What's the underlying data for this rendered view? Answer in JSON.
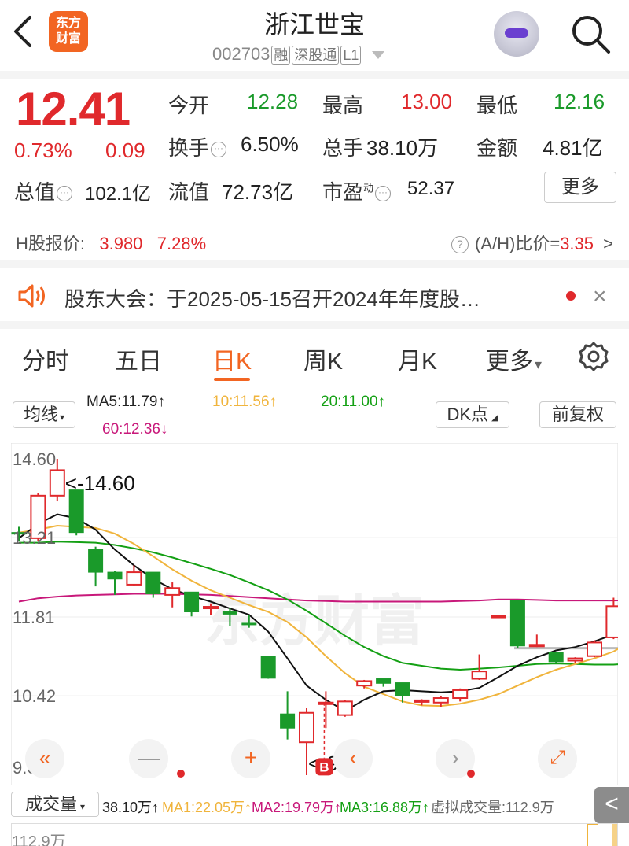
{
  "header": {
    "logo_text": [
      "东方",
      "财富"
    ],
    "title": "浙江世宝",
    "code": "002703",
    "tags": [
      "融",
      "深股通",
      "L1"
    ]
  },
  "quote": {
    "price": "12.41",
    "change_pct": "0.73%",
    "change": "0.09",
    "open_label": "今开",
    "open": "12.28",
    "high_label": "最高",
    "high": "13.00",
    "low_label": "最低",
    "low": "12.16",
    "turnover_label": "换手",
    "turnover": "6.50%",
    "volume_label": "总手",
    "volume": "38.10万",
    "amount_label": "金额",
    "amount": "4.81亿",
    "mktcap_label": "总值",
    "mktcap": "102.1亿",
    "float_label": "流值",
    "float": "72.73亿",
    "pe_label": "市盈",
    "pe_sup": "动",
    "pe": "52.37",
    "more": "更多"
  },
  "hshare": {
    "label": "H股报价:",
    "price": "3.980",
    "pct": "7.28%",
    "ah_label": "(A/H)比价=",
    "ah_value": "3.35",
    "arrow": ">"
  },
  "notice": {
    "text": "股东大会：于2025-05-15召开2024年年度股…",
    "close": "×"
  },
  "tabs": [
    "分时",
    "五日",
    "日K",
    "周K",
    "月K",
    "更多"
  ],
  "tab_more_arrow": "▾",
  "ma_bar": {
    "mode": "均线",
    "ma5": "MA5:11.79↑",
    "ma10": "10:11.56↑",
    "ma20": "20:11.00↑",
    "ma60": "60:12.36↓",
    "dk": "DK点",
    "adjust": "前复权"
  },
  "colors": {
    "up": "#e0292c",
    "down": "#1a9a2a",
    "ma5": "#111111",
    "ma10": "#f0b43c",
    "ma20": "#14a014",
    "ma60": "#c8187a",
    "accent": "#f26522",
    "signal": "#3aa0e8"
  },
  "chart_data": {
    "type": "candlestick",
    "y_ticks": [
      "14.60",
      "13.21",
      "11.81",
      "10.42",
      "9.02"
    ],
    "ylim": [
      9.02,
      14.6
    ],
    "max_label": "<-14.60",
    "min_label": "<-9.02",
    "buy_marker": "B",
    "sell_marker": "S",
    "candles": [
      {
        "o": 13.3,
        "h": 13.4,
        "l": 13.15,
        "c": 13.28
      },
      {
        "o": 13.2,
        "h": 14.0,
        "l": 13.15,
        "c": 13.95
      },
      {
        "o": 13.95,
        "h": 14.6,
        "l": 13.85,
        "c": 14.4
      },
      {
        "o": 14.05,
        "h": 14.05,
        "l": 13.25,
        "c": 13.3
      },
      {
        "o": 13.0,
        "h": 13.05,
        "l": 12.35,
        "c": 12.6
      },
      {
        "o": 12.6,
        "h": 12.62,
        "l": 12.2,
        "c": 12.48
      },
      {
        "o": 12.38,
        "h": 12.72,
        "l": 12.36,
        "c": 12.6
      },
      {
        "o": 12.6,
        "h": 12.6,
        "l": 12.15,
        "c": 12.22
      },
      {
        "o": 12.2,
        "h": 12.42,
        "l": 11.98,
        "c": 12.32
      },
      {
        "o": 12.25,
        "h": 12.25,
        "l": 11.82,
        "c": 11.9
      },
      {
        "o": 11.98,
        "h": 12.05,
        "l": 11.85,
        "c": 11.99
      },
      {
        "o": 11.9,
        "h": 11.97,
        "l": 11.65,
        "c": 11.86
      },
      {
        "o": 11.7,
        "h": 11.85,
        "l": 11.62,
        "c": 11.68
      },
      {
        "o": 11.12,
        "h": 11.12,
        "l": 10.72,
        "c": 10.73
      },
      {
        "o": 10.1,
        "h": 10.5,
        "l": 9.65,
        "c": 9.85
      },
      {
        "o": 9.6,
        "h": 10.2,
        "l": 9.02,
        "c": 10.12
      },
      {
        "o": 10.3,
        "h": 10.5,
        "l": 9.85,
        "c": 10.3
      },
      {
        "o": 10.08,
        "h": 10.35,
        "l": 10.05,
        "c": 10.32
      },
      {
        "o": 10.6,
        "h": 10.7,
        "l": 10.55,
        "c": 10.68
      },
      {
        "o": 10.72,
        "h": 10.72,
        "l": 10.58,
        "c": 10.64
      },
      {
        "o": 10.65,
        "h": 10.65,
        "l": 10.3,
        "c": 10.42
      },
      {
        "o": 10.33,
        "h": 10.36,
        "l": 10.25,
        "c": 10.34
      },
      {
        "o": 10.3,
        "h": 10.42,
        "l": 10.22,
        "c": 10.38
      },
      {
        "o": 10.38,
        "h": 10.55,
        "l": 10.32,
        "c": 10.52
      },
      {
        "o": 10.72,
        "h": 11.15,
        "l": 10.7,
        "c": 10.85
      },
      {
        "o": 11.82,
        "h": 11.84,
        "l": 11.8,
        "c": 11.83
      },
      {
        "o": 12.1,
        "h": 12.1,
        "l": 11.26,
        "c": 11.3
      },
      {
        "o": 11.3,
        "h": 11.5,
        "l": 11.28,
        "c": 11.32
      },
      {
        "o": 11.18,
        "h": 11.18,
        "l": 11.0,
        "c": 11.02
      },
      {
        "o": 11.04,
        "h": 11.1,
        "l": 11.0,
        "c": 11.08
      },
      {
        "o": 11.12,
        "h": 11.4,
        "l": 11.1,
        "c": 11.36
      },
      {
        "o": 11.45,
        "h": 12.15,
        "l": 11.42,
        "c": 12.0
      },
      {
        "o": 12.05,
        "h": 12.5,
        "l": 11.92,
        "c": 12.18
      }
    ],
    "ma5": [
      13.2,
      13.45,
      13.62,
      13.55,
      13.35,
      13.0,
      12.72,
      12.48,
      12.3,
      12.18,
      12.08,
      11.96,
      11.85,
      11.55,
      11.08,
      10.6,
      10.35,
      10.15,
      10.35,
      10.5,
      10.52,
      10.5,
      10.48,
      10.5,
      10.56,
      10.75,
      10.95,
      11.1,
      11.22,
      11.28,
      11.38,
      11.5,
      11.68
    ],
    "ma10": [
      13.3,
      13.35,
      13.42,
      13.4,
      13.38,
      13.28,
      13.1,
      12.88,
      12.65,
      12.45,
      12.28,
      12.15,
      12.02,
      11.9,
      11.72,
      11.45,
      11.12,
      10.82,
      10.58,
      10.45,
      10.32,
      10.25,
      10.24,
      10.28,
      10.35,
      10.45,
      10.6,
      10.75,
      10.88,
      10.98,
      11.08,
      11.2,
      11.4
    ],
    "ma20": [
      13.12,
      13.12,
      13.14,
      13.13,
      13.12,
      13.08,
      13.02,
      12.95,
      12.86,
      12.76,
      12.66,
      12.55,
      12.42,
      12.28,
      12.12,
      11.92,
      11.7,
      11.48,
      11.28,
      11.12,
      11.0,
      10.95,
      10.9,
      10.88,
      10.9,
      10.92,
      10.95,
      10.98,
      10.99,
      10.98,
      10.97,
      10.97,
      10.99
    ],
    "ma60": [
      12.08,
      12.14,
      12.17,
      12.19,
      12.2,
      12.21,
      12.22,
      12.22,
      12.22,
      12.21,
      12.2,
      12.18,
      12.16,
      12.14,
      12.12,
      12.1,
      12.09,
      12.08,
      12.08,
      12.08,
      12.08,
      12.08,
      12.08,
      12.09,
      12.1,
      12.12,
      12.12,
      12.11,
      12.1,
      12.1,
      12.1,
      12.1,
      12.11
    ]
  },
  "volume_bar": {
    "mode": "成交量",
    "vol": "38.10万↑",
    "ma1": "MA1:22.05万↑",
    "ma2": "MA2:19.79万↑",
    "ma3": "MA3:16.88万↑",
    "virtual": "虚拟成交量:112.9万",
    "axis_top": "112.9万",
    "collapse": "<"
  },
  "chart_controls": [
    "«",
    "—",
    "+",
    "‹",
    "›",
    "⤢"
  ]
}
